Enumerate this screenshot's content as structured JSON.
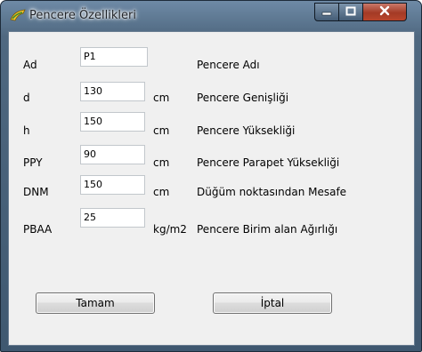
{
  "window": {
    "title": "Pencere Özellikleri",
    "icon": "app-icon"
  },
  "controls": {
    "minimize_icon": "minimize-icon",
    "maximize_icon": "maximize-icon",
    "close_icon": "close-icon"
  },
  "rows": [
    {
      "key": "Ad",
      "value": "P1",
      "unit": "",
      "desc": "Pencere Adı"
    },
    {
      "key": "d",
      "value": "130",
      "unit": "cm",
      "desc": "Pencere Genişliği"
    },
    {
      "key": "h",
      "value": "150",
      "unit": "cm",
      "desc": "Pencere Yüksekliği"
    },
    {
      "key": "PPY",
      "value": "90",
      "unit": "cm",
      "desc": "Pencere Parapet Yüksekliği"
    },
    {
      "key": "DNM",
      "value": "150",
      "unit": "cm",
      "desc": "Düğüm noktasından Mesafe"
    },
    {
      "key": "PBAA",
      "value": "25",
      "unit": "kg/m2",
      "desc": "Pencere Birim alan Ağırlığı"
    }
  ],
  "buttons": {
    "ok": "Tamam",
    "cancel": "İptal"
  },
  "colors": {
    "close_button": "#b9452b",
    "frame": "#4f6880",
    "client_bg": "#f0f0f0"
  }
}
